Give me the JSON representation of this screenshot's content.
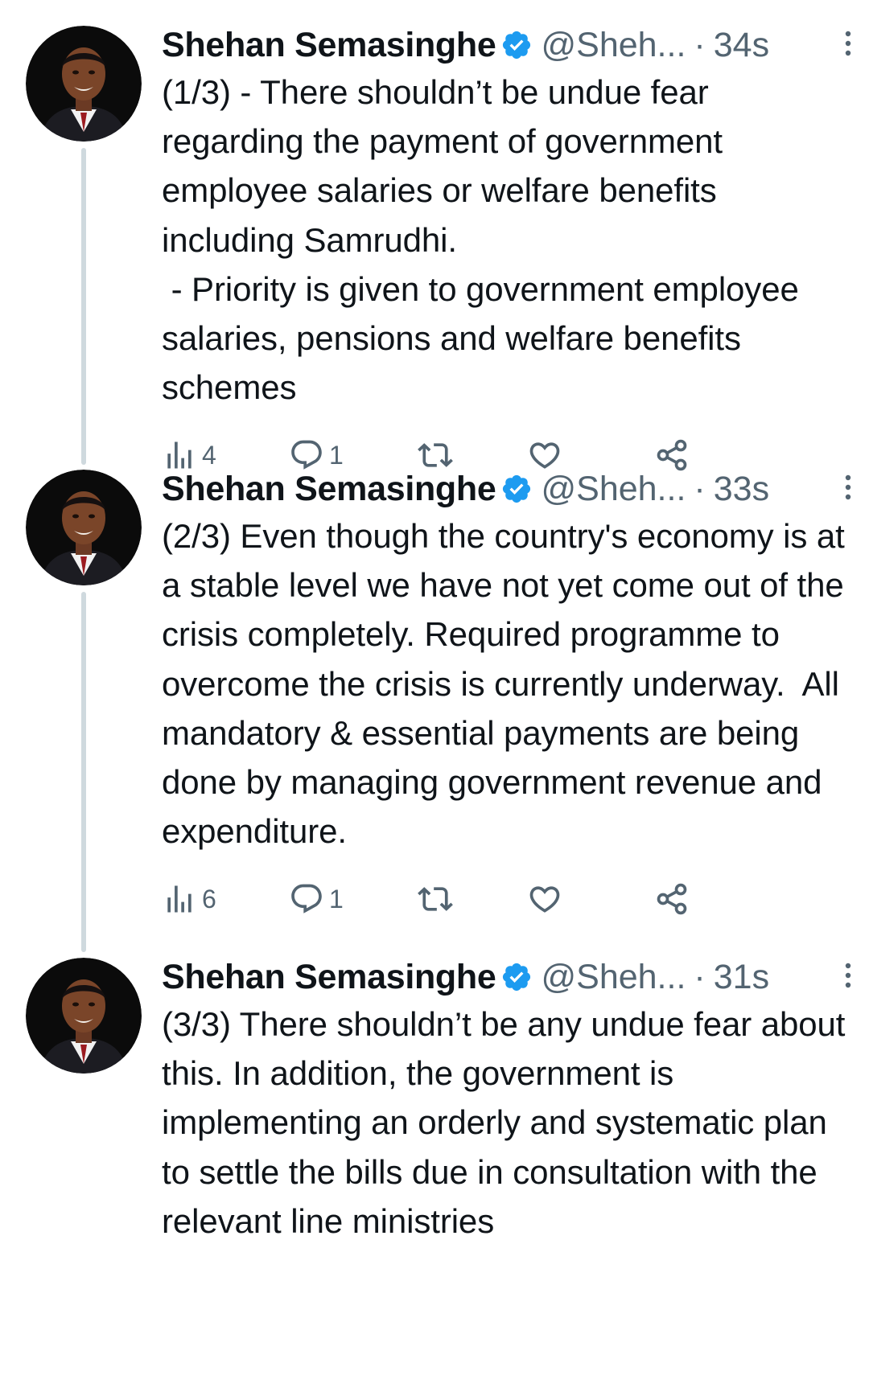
{
  "colors": {
    "text_primary": "#0f1419",
    "text_secondary": "#536471",
    "verified_blue": "#1d9bf0",
    "thread_line": "#cfd9de"
  },
  "tweets": [
    {
      "name": "Shehan Semasinghe",
      "handle": "@Sheh...",
      "separator": "·",
      "time": "34s",
      "text": "(1/3) - There shouldn’t be undue fear regarding the payment of government employee salaries or welfare benefits including Samrudhi.\n - Priority is given to government employee salaries, pensions and welfare benefits schemes",
      "views": "4",
      "replies": "1"
    },
    {
      "name": "Shehan Semasinghe",
      "handle": "@Sheh...",
      "separator": "·",
      "time": "33s",
      "text": "(2/3) Even though the country's economy is at a stable level we have not yet come out of the crisis completely. Required programme to overcome the crisis is currently underway.  All mandatory & essential payments are being done by managing government revenue and expenditure.",
      "views": "6",
      "replies": "1"
    },
    {
      "name": "Shehan Semasinghe",
      "handle": "@Sheh...",
      "separator": "·",
      "time": "31s",
      "text": "(3/3) There shouldn’t be any undue fear about this. In addition, the government is implementing an orderly and systematic plan to settle the bills due in consultation with the relevant line ministries"
    }
  ]
}
